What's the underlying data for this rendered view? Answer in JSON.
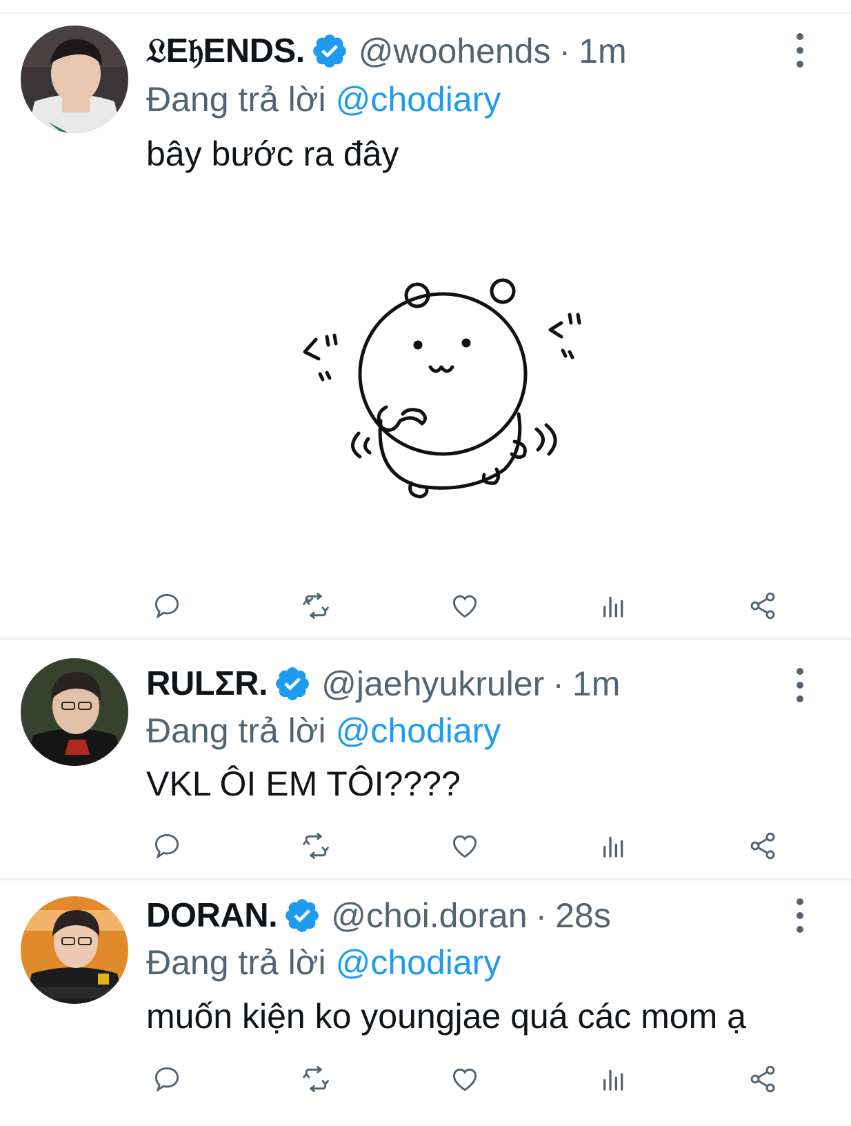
{
  "colors": {
    "text_primary": "#0f1419",
    "text_secondary": "#536471",
    "accent": "#1d9bf0",
    "divider": "#eff3f4"
  },
  "tweets": [
    {
      "name": "𝔏E𝔥ENDS.",
      "handle": "@woohends",
      "dot": "·",
      "time": "1m",
      "reply_prefix": "Đang trả lời",
      "reply_to": "@chodiary",
      "text": "bây bước ra đây",
      "verified": true,
      "has_media": true,
      "media_icon": "bear-sticker-image"
    },
    {
      "name": "RULΣR.",
      "handle": "@jaehyukruler",
      "dot": "·",
      "time": "1m",
      "reply_prefix": "Đang trả lời",
      "reply_to": "@chodiary",
      "text": "VKL ÔI EM TÔI????",
      "verified": true,
      "has_media": false
    },
    {
      "name": "DORAN.",
      "handle": "@choi.doran",
      "dot": "·",
      "time": "28s",
      "reply_prefix": "Đang trả lời",
      "reply_to": "@chodiary",
      "text": "muốn kiện ko youngjae quá các mom ạ",
      "verified": true,
      "has_media": false
    }
  ],
  "action_icons": [
    "reply-icon",
    "retweet-icon",
    "like-icon",
    "views-icon",
    "share-icon"
  ]
}
